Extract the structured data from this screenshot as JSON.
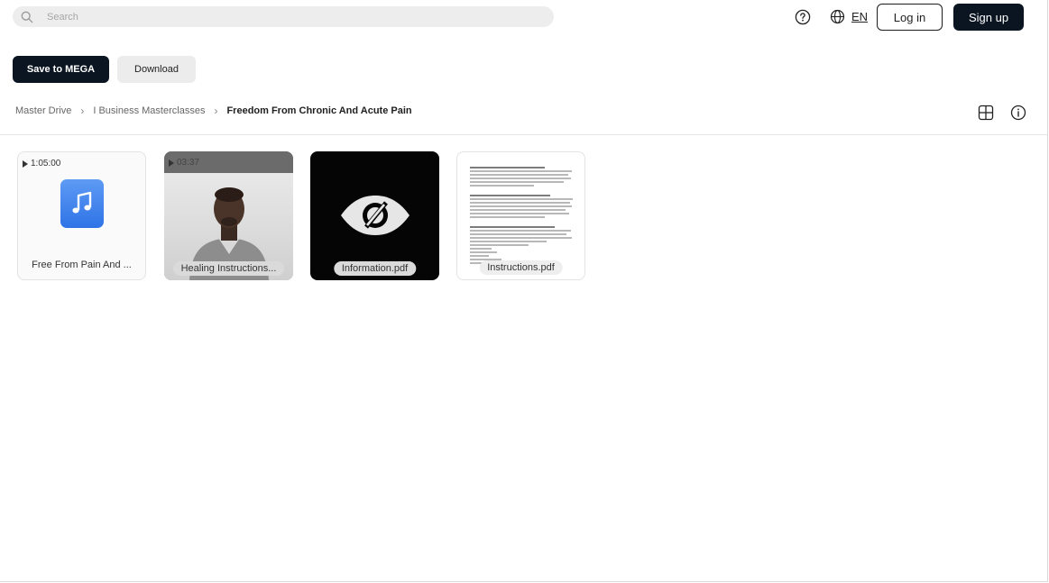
{
  "search": {
    "placeholder": "Search"
  },
  "header": {
    "language": "EN",
    "login_label": "Log in",
    "signup_label": "Sign up"
  },
  "actions": {
    "save_label": "Save to MEGA",
    "download_label": "Download"
  },
  "breadcrumb": [
    {
      "label": "Master Drive"
    },
    {
      "label": "I Business Masterclasses"
    },
    {
      "label": "Freedom From Chronic And Acute Pain"
    }
  ],
  "files": [
    {
      "name": "Free From Pain And ...",
      "type": "audio",
      "duration": "1:05:00",
      "icon": "music-note-icon"
    },
    {
      "name": "Healing Instructions...",
      "type": "video",
      "duration": "03:37",
      "icon": "video-thumbnail"
    },
    {
      "name": "Information.pdf",
      "type": "pdf",
      "icon": "eye-slash-icon"
    },
    {
      "name": "Instructions.pdf",
      "type": "pdf",
      "icon": "document-thumbnail"
    }
  ],
  "colors": {
    "primary": "#0b1521",
    "secondary_button": "#ececec",
    "search_bg": "#ededed",
    "music_icon": "#3b7eec"
  }
}
